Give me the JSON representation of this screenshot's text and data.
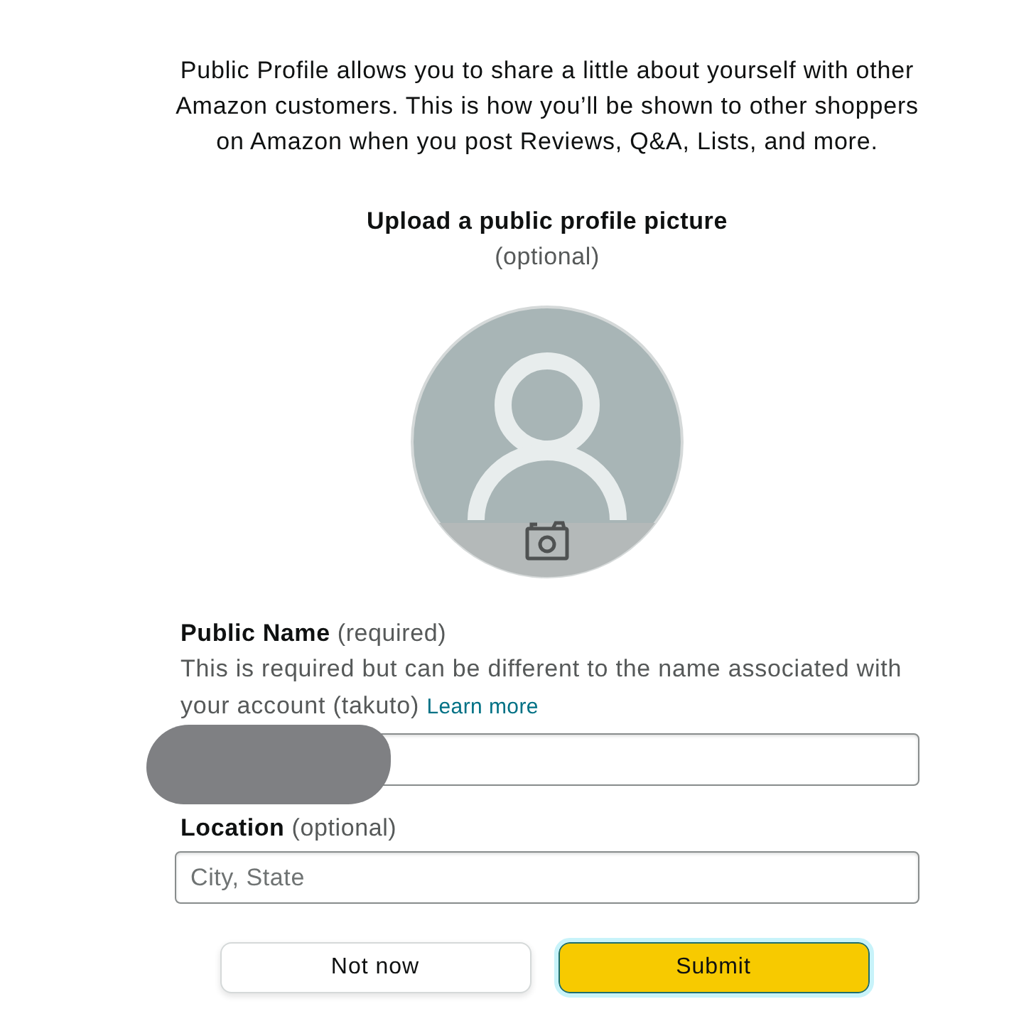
{
  "intro": "Public Profile allows you to share a little about yourself with other Amazon customers. This is how you’ll be shown to other shoppers on Amazon when you post Reviews, Q&A, Lists, and more.",
  "photo_section": {
    "title": "Upload a public profile picture",
    "note": "(optional)"
  },
  "fields": [
    {
      "label": "Public Name",
      "note": "(required)",
      "help": "This is required but can be different to the name associated with your account (takuto)",
      "link": "Learn more",
      "redacted": true
    },
    {
      "label": "Location",
      "note": "(optional)",
      "placeholder": "City, State",
      "redacted": false
    }
  ],
  "buttons": [
    {
      "label": "Not now",
      "kind": "secondary",
      "focused": false
    },
    {
      "label": "Submit",
      "kind": "primary",
      "focused": true
    }
  ]
}
